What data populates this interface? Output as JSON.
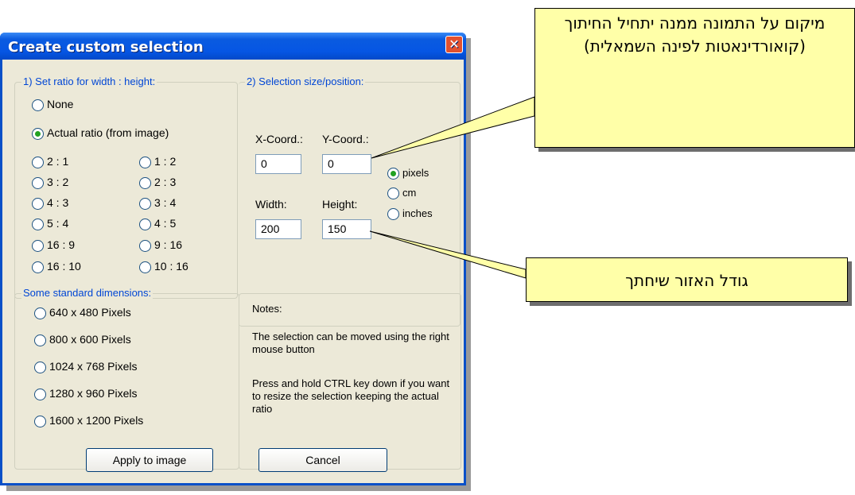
{
  "dialog": {
    "title": "Create custom selection",
    "close_glyph": "✕",
    "ratio_group": {
      "title": "1) Set ratio for width : height:",
      "options": [
        "None",
        "Actual ratio (from image)"
      ],
      "selected": "Actual ratio (from image)",
      "pairs": [
        [
          "2 : 1",
          "1 : 2"
        ],
        [
          "3 : 2",
          "2 : 3"
        ],
        [
          "4 : 3",
          "3 : 4"
        ],
        [
          "5 : 4",
          "4 : 5"
        ],
        [
          "16 : 9",
          "9 : 16"
        ],
        [
          "16 : 10",
          "10 : 16"
        ]
      ]
    },
    "selection_group": {
      "title": "2) Selection size/position:",
      "x_label": "X-Coord.:",
      "y_label": "Y-Coord.:",
      "x_value": "0",
      "y_value": "0",
      "width_label": "Width:",
      "height_label": "Height:",
      "width_value": "200",
      "height_value": "150",
      "units": [
        "pixels",
        "cm",
        "inches"
      ],
      "selected_unit": "pixels"
    },
    "standard_group": {
      "title": "Some standard dimensions:",
      "options": [
        "640 x 480 Pixels",
        "800 x 600 Pixels",
        "1024 x 768 Pixels",
        "1280 x 960 Pixels",
        "1600 x 1200 Pixels"
      ]
    },
    "notes": {
      "title": "Notes:",
      "note1": "The selection can be moved using the right mouse button",
      "note2": "Press and hold CTRL key down if you want to resize the selection keeping the actual ratio"
    },
    "buttons": {
      "apply": "Apply to image",
      "cancel": "Cancel"
    }
  },
  "callouts": {
    "top": "מיקום על התמונה ממנה יתחיל החיתוך (קואורדינאטות לפינה השמאלית)",
    "bottom": "גודל האזור שיחתך"
  },
  "colors": {
    "titlebar": "#0656e4",
    "group_title": "#0046d5",
    "callout_bg": "#ffffa8",
    "radio_checked": "#21a121"
  }
}
